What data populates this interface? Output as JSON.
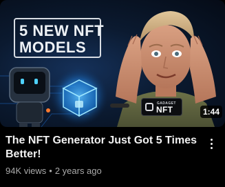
{
  "video": {
    "thumbnail": {
      "headline_line1": "5 NEW NFT",
      "headline_line2": "MODELS",
      "badge_small": "GADAGET",
      "badge_big": "NFT",
      "duration": "1:44"
    },
    "title": "The NFT Generator Just Got 5 Times Better!",
    "views": "94K views",
    "separator": "•",
    "age": "2 years ago",
    "menu_icon": "more-vert-icon"
  },
  "colors": {
    "background": "#000000",
    "title": "#f1f1f1",
    "meta": "#aaaaaa",
    "thumb_glow": "#2fa6ff"
  }
}
